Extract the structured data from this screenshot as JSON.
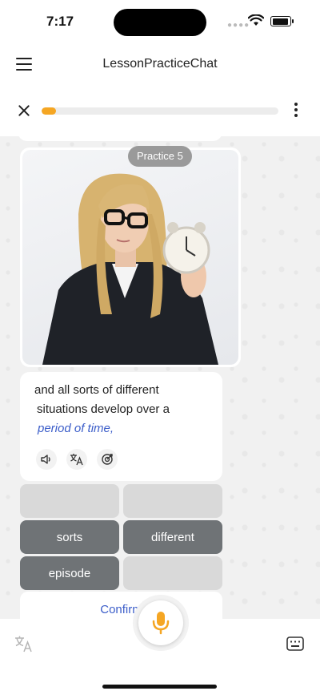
{
  "status_bar": {
    "time": "7:17"
  },
  "nav": {
    "title": "LessonPracticeChat"
  },
  "progress": {
    "fraction": 0.06,
    "color": "#f5a623"
  },
  "practice_badge": "Practice 5",
  "message": {
    "lines": [
      "and all sorts of different",
      "situations develop over a",
      "period of time,"
    ],
    "highlight_color": "#3b5dc9"
  },
  "word_options": [
    "sorts",
    "different",
    "episode"
  ],
  "confirm_label": "Confirm",
  "colors": {
    "accent": "#f5a623",
    "link": "#3b5dc9",
    "chip": "#6f7376"
  },
  "icons": [
    "menu-icon",
    "close-icon",
    "more-vertical-icon",
    "speaker-icon",
    "translate-icon",
    "target-icon",
    "microphone-icon",
    "keyboard-icon"
  ]
}
